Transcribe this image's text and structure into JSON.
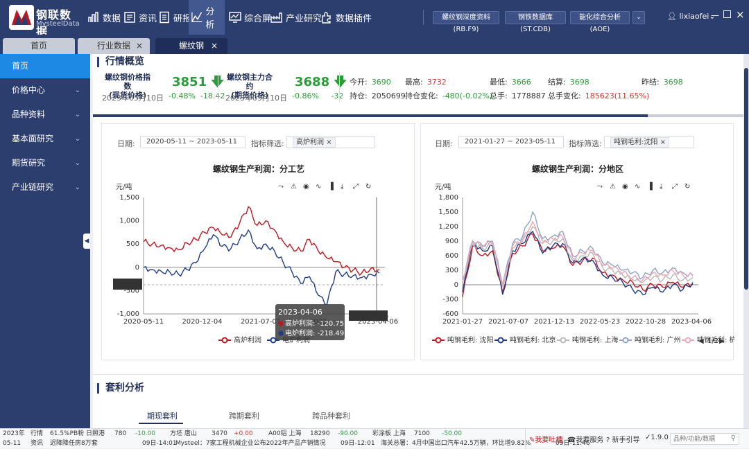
{
  "brand": {
    "cn": "钢联数据",
    "en": "MysteelData"
  },
  "nav": [
    {
      "label": "数据",
      "icon": "bar-chart-icon"
    },
    {
      "label": "资讯",
      "icon": "news-icon"
    },
    {
      "label": "研报",
      "icon": "report-icon"
    },
    {
      "label": "分析",
      "icon": "analysis-icon"
    },
    {
      "label": "综合屏",
      "icon": "monitor-icon"
    },
    {
      "label": "产业研究",
      "icon": "industry-icon"
    },
    {
      "label": "数据插件",
      "icon": "plugin-icon"
    }
  ],
  "pills": [
    "螺纹钢深度资料(RB.F9)",
    "钢铁数据库(ST.CDB)",
    "能化综合分析(AOE)"
  ],
  "user": "lixiaofei",
  "tabs": [
    "首页",
    "行业数据",
    "螺纹钢"
  ],
  "sidebar": [
    "首页",
    "价格中心",
    "品种资料",
    "基本面研究",
    "期货研究",
    "产业链研究"
  ],
  "overview": {
    "title": "行情概览",
    "spot": {
      "name1": "螺纹钢价格指数",
      "name2": "(现货价格)",
      "date": "2023年05月10日",
      "price": "3851",
      "pct": "-0.48%",
      "chg": "-18.42"
    },
    "fut": {
      "name1": "螺纹钢主力合约",
      "name2": "(期货价格)",
      "date": "2023年05月10日",
      "price": "3688",
      "pct": "-0.86%",
      "chg": "-32"
    },
    "kv": [
      {
        "k": "今开:",
        "v": "3690",
        "c": "g"
      },
      {
        "k": "最高:",
        "v": "3732",
        "c": "r"
      },
      {
        "k": "最低:",
        "v": "3666",
        "c": "g"
      },
      {
        "k": "结算:",
        "v": "3698",
        "c": "g"
      },
      {
        "k": "昨结:",
        "v": "3698",
        "c": "g"
      },
      {
        "k": "持仓:",
        "v": "2050699",
        "c": ""
      },
      {
        "k": "持仓变化:",
        "v": "-480(-0.02%)",
        "c": "g"
      },
      {
        "k": "总手:",
        "v": "1778887",
        "c": ""
      },
      {
        "k": "总手变化:",
        "v": "185623(11.65%)",
        "c": "r"
      }
    ]
  },
  "charts": [
    {
      "filter": {
        "date_label": "日期:",
        "date_range": "2020-05-11  ~  2023-05-11",
        "ind_label": "指标筛选:",
        "chip": "高炉利润"
      },
      "chart_data": {
        "type": "line",
        "title": "螺纹钢生产利润：分工艺",
        "ylabel": "元/吨",
        "ylim": [
          -1000,
          1500
        ],
        "yticks": [
          "1,500",
          "1,000",
          "500",
          "0",
          "-500",
          "-1,000"
        ],
        "xticks": [
          "2020-05-11",
          "2020-12-04",
          "2021-07-01",
          "2022-",
          "2023-04-06"
        ],
        "series": [
          {
            "name": "高炉利润",
            "color": "#c0171f",
            "values": [
              550,
              500,
              470,
              420,
              380,
              520,
              600,
              750,
              850,
              700,
              650,
              950,
              1300,
              900,
              1000,
              800,
              550,
              420,
              350,
              600,
              350,
              200,
              120,
              0,
              -60,
              -121,
              -30,
              -50
            ]
          },
          {
            "name": "电炉利润",
            "color": "#1d3c87",
            "values": [
              0,
              -50,
              -80,
              -100,
              -150,
              -50,
              100,
              400,
              700,
              450,
              400,
              600,
              800,
              400,
              500,
              350,
              100,
              -100,
              -350,
              -200,
              -600,
              -800,
              -100,
              -150,
              -180,
              -218,
              -150,
              -120
            ]
          }
        ],
        "ref_line": -375,
        "ref_label": "-375.00",
        "cursor_label": "2023-04-06",
        "tooltip": {
          "date": "2023-04-06",
          "rows": [
            {
              "label": "高炉利润: -120.75",
              "color": "#c0171f"
            },
            {
              "label": "电炉利润: -218.49",
              "color": "#1d3c87"
            }
          ]
        }
      }
    },
    {
      "filter": {
        "date_label": "日期:",
        "date_range": "2021-01-27  ~  2023-05-11",
        "ind_label": "指标筛选:",
        "chip": "吨钢毛利:沈阳"
      },
      "chart_data": {
        "type": "line",
        "title": "螺纹钢生产利润：分地区",
        "ylabel": "元/吨",
        "ylim": [
          -600,
          1800
        ],
        "yticks": [
          "1,800",
          "1,500",
          "1,200",
          "900",
          "600",
          "300",
          "0",
          "-300",
          "-600"
        ],
        "xticks": [
          "2021-01-27",
          "2021-07-07",
          "2021-12-13",
          "2022-05-23",
          "2022-10-28",
          "2023-04-06"
        ],
        "series": [
          {
            "name": "吨钢毛利: 沈阳",
            "color": "#c0171f",
            "values": [
              -250,
              800,
              600,
              700,
              -150,
              650,
              800,
              1050,
              700,
              750,
              800,
              400,
              500,
              550,
              250,
              200,
              100,
              50,
              -100,
              0,
              -50,
              50,
              -50,
              20
            ]
          },
          {
            "name": "吨钢毛利: 北京",
            "color": "#1d3c87",
            "values": [
              -150,
              900,
              700,
              800,
              -200,
              700,
              850,
              1100,
              650,
              800,
              850,
              450,
              550,
              500,
              200,
              150,
              50,
              -100,
              -200,
              -50,
              -150,
              0,
              -100,
              50
            ]
          },
          {
            "name": "吨钢毛利: 上海",
            "color": "#b8b8b8",
            "values": [
              50,
              850,
              750,
              850,
              -50,
              750,
              900,
              1200,
              850,
              900,
              950,
              500,
              600,
              650,
              350,
              300,
              200,
              100,
              50,
              150,
              100,
              200,
              100,
              150
            ]
          },
          {
            "name": "吨钢毛利: 广州",
            "color": "#8fa3cc",
            "values": [
              100,
              900,
              800,
              900,
              0,
              850,
              1000,
              1500,
              950,
              1000,
              1100,
              600,
              700,
              750,
              450,
              400,
              300,
              250,
              150,
              300,
              250,
              350,
              250,
              200
            ]
          },
          {
            "name": "吨钢毛利: 杭州",
            "color": "#f0a7b3",
            "values": [
              80,
              880,
              780,
              880,
              -30,
              800,
              950,
              1300,
              900,
              950,
              1000,
              550,
              650,
              700,
              400,
              350,
              250,
              150,
              100,
              250,
              200,
              300,
              200,
              180
            ]
          }
        ],
        "pager": "1/2"
      }
    }
  ],
  "arb": {
    "title": "套利分析",
    "tabs": [
      "期现套利",
      "跨期套利",
      "跨品种套利"
    ]
  },
  "status": {
    "row1": [
      {
        "t": "2023年",
        "c": ""
      },
      {
        "t": "行情",
        "c": ""
      },
      {
        "t": "61.5%PB粉 日照港",
        "c": ""
      },
      {
        "t": "780",
        "c": ""
      },
      {
        "t": "-10.00",
        "c": "g"
      },
      {
        "t": "方坯 唐山",
        "c": ""
      },
      {
        "t": "3470",
        "c": ""
      },
      {
        "t": "+0.00",
        "c": "r"
      },
      {
        "t": "A00铝 上海",
        "c": ""
      },
      {
        "t": "18290",
        "c": ""
      },
      {
        "t": "-90.00",
        "c": "g"
      },
      {
        "t": "彩涂板 上海",
        "c": ""
      },
      {
        "t": "7100",
        "c": ""
      },
      {
        "t": "-50.00",
        "c": "g"
      }
    ],
    "row2": [
      {
        "t": "05-11",
        "c": ""
      },
      {
        "t": "资讯",
        "c": ""
      },
      {
        "t": "迟降降任房8万套",
        "c": ""
      },
      {
        "t": "09日-14:01",
        "c": ""
      },
      {
        "t": "Mysteel：7家工程机械企业公布2022年产品产销情况",
        "c": ""
      },
      {
        "t": "09日-12:01",
        "c": ""
      },
      {
        "t": "海关总署：4月中国出口汽车42.5万辆，环比增9.82%",
        "c": ""
      },
      {
        "t": "09日-11:46",
        "c": ""
      }
    ],
    "buttons": [
      "我要吐槽",
      "我要服务",
      "新手引导",
      "1.9.0"
    ],
    "search_placeholder": "品种/功能/数据"
  }
}
